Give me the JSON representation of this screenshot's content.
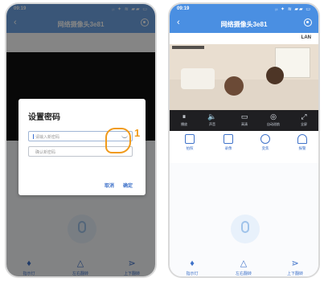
{
  "left": {
    "statusbar": {
      "time": "09:19",
      "icons": "ᵢₗ ✦ ≋ ▰▰ ▭"
    },
    "navbar": {
      "back": "‹",
      "title": "网络摄像头3e81"
    },
    "dialog": {
      "title": "设置密码",
      "new_password_placeholder": "请输入新密码",
      "confirm_password_placeholder": "确认新密码",
      "cancel": "取消",
      "confirm": "确定"
    },
    "step_number": "1",
    "bottom": [
      {
        "icon": "flashlight-icon",
        "label": "指示灯"
      },
      {
        "icon": "triangle-icon",
        "label": "左右翻转"
      },
      {
        "icon": "flip-icon",
        "label": "上下翻转"
      }
    ]
  },
  "right": {
    "statusbar": {
      "time": "09:19",
      "icons": "ᵢₗ ✦ ≋ ▰▰ ▭"
    },
    "navbar": {
      "back": "‹",
      "title": "网络摄像头3e81"
    },
    "lan": "LAN",
    "controls": [
      {
        "icon": "⏸",
        "label": "播放"
      },
      {
        "icon": "🔈",
        "label": "声音"
      },
      {
        "icon": "▭",
        "label": "高清"
      },
      {
        "icon": "◎",
        "label": "自动巡航"
      },
      {
        "icon": "⤢",
        "label": "全屏"
      }
    ],
    "functions": [
      {
        "icon": "camera-icon",
        "label": "拍照"
      },
      {
        "icon": "record-icon",
        "label": "录像"
      },
      {
        "icon": "wheel-icon",
        "label": "变焦"
      },
      {
        "icon": "alarm-icon",
        "label": "报警"
      }
    ],
    "bottom": [
      {
        "icon": "flashlight-icon",
        "label": "指示灯"
      },
      {
        "icon": "triangle-icon",
        "label": "左右翻转"
      },
      {
        "icon": "flip-icon",
        "label": "上下翻转"
      }
    ]
  },
  "colors": {
    "accent": "#3f72c9",
    "header_dimmed": "#6fa6e6",
    "header": "#4a8fe2",
    "pointer": "#f09a1a"
  }
}
